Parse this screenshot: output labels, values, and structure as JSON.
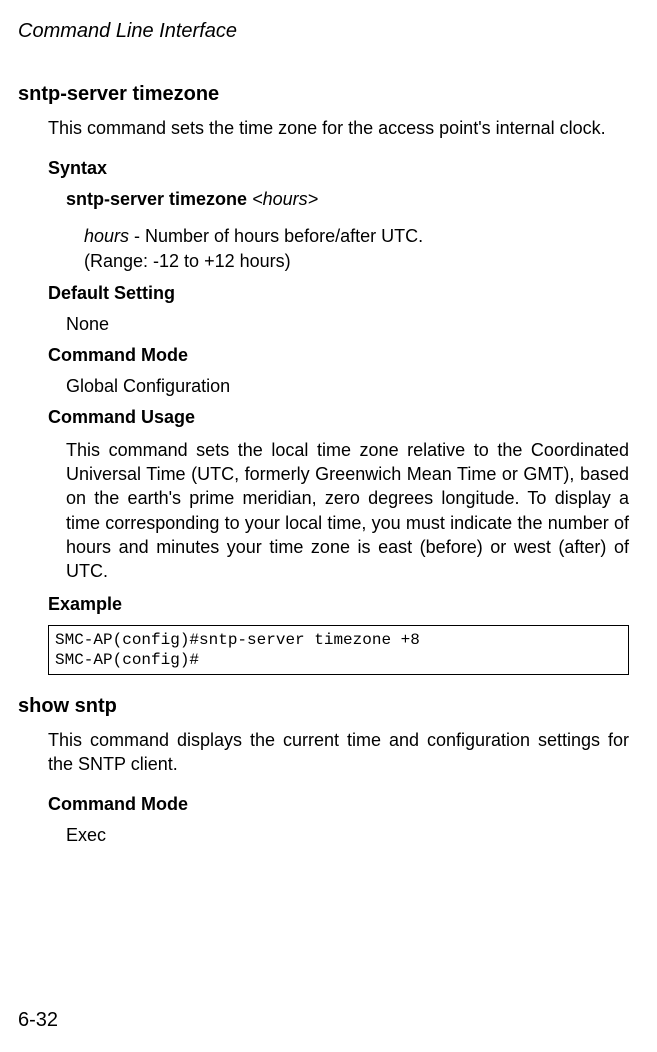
{
  "header": "Command Line Interface",
  "page_number": "6-32",
  "section1": {
    "title": "sntp-server timezone",
    "desc": "This command sets the time zone for the access point's internal clock.",
    "syntax_label": "Syntax",
    "syntax_cmd_bold": "sntp-server timezone",
    "syntax_cmd_param": "<hours>",
    "param_name": "hours",
    "param_desc_rest": " - Number of hours before/after UTC.",
    "param_range": "(Range: -12 to +12 hours)",
    "default_label": "Default Setting",
    "default_value": "None",
    "mode_label": "Command Mode",
    "mode_value": "Global Configuration",
    "usage_label": "Command Usage",
    "usage_text": "This command sets the local time zone relative to the Coordinated Universal Time (UTC, formerly Greenwich Mean Time or GMT), based on the earth's prime meridian, zero degrees longitude. To display a time corresponding to your local time, you must indicate the number of hours and minutes your time zone is east (before) or west (after) of UTC.",
    "example_label": "Example",
    "example_text": "SMC-AP(config)#sntp-server timezone +8\nSMC-AP(config)#"
  },
  "section2": {
    "title": "show sntp",
    "desc": "This command displays the current time and configuration settings for the SNTP client.",
    "mode_label": "Command Mode",
    "mode_value": "Exec"
  }
}
